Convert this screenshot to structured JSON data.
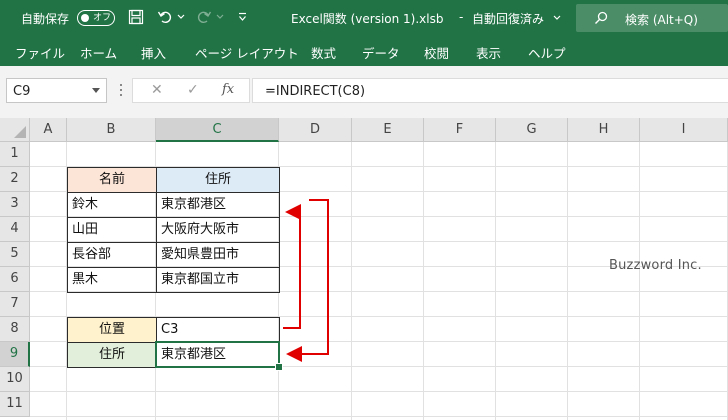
{
  "titlebar": {
    "autosave_label": "自動保存",
    "autosave_state": "オフ",
    "filename": "Excel関数 (version 1).xlsb",
    "save_status": "自動回復済み",
    "search_label": "検索 (Alt+Q)"
  },
  "menu": [
    "ファイル",
    "ホーム",
    "挿入",
    "ページ レイアウト",
    "数式",
    "データ",
    "校閲",
    "表示",
    "ヘルプ"
  ],
  "formula_bar": {
    "name_box": "C9",
    "cancel_symbol": "✕",
    "enter_symbol": "✓",
    "fx_symbol": "fx",
    "formula": "=INDIRECT(C8)"
  },
  "columns": [
    "A",
    "B",
    "C",
    "D",
    "E",
    "F",
    "G",
    "H",
    "I"
  ],
  "rows": [
    "1",
    "2",
    "3",
    "4",
    "5",
    "6",
    "7",
    "8",
    "9",
    "10",
    "11"
  ],
  "selected_column": "C",
  "selected_row": "9",
  "cells": {
    "B2": "名前",
    "C2": "住所",
    "B3": "鈴木",
    "C3": "東京都港区",
    "B4": "山田",
    "C4": "大阪府大阪市",
    "B5": "長谷部",
    "C5": "愛知県豊田市",
    "B6": "黒木",
    "C6": "東京都国立市",
    "B8": "位置",
    "C8": "C3",
    "B9": "住所",
    "C9": "東京都港区"
  },
  "colors": {
    "excel_green": "#217346",
    "header_name_fill": "#fce4d6",
    "header_address_fill": "#ddebf7",
    "position_fill": "#fff2cc",
    "result_fill": "#e2efda",
    "arrow_red": "#e00000"
  },
  "watermark": "Buzzword Inc."
}
